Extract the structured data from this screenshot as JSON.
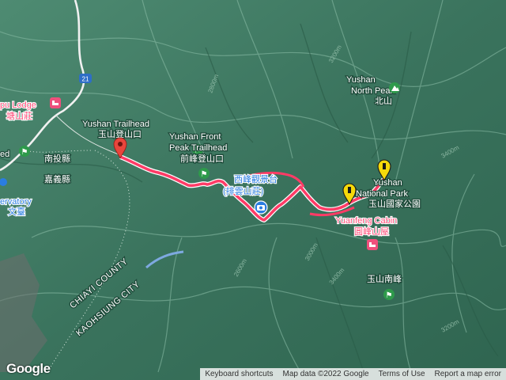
{
  "map": {
    "colors": {
      "terrain": "#3e7a63",
      "ridge": "#7fb39d",
      "route": "#ff3b66",
      "pin_red": "#e8453c",
      "pin_yellow": "#f5d90a",
      "hiker": "#2e9a4b",
      "lodging": "#ef4f7c",
      "river": "#7ea9e0",
      "road": "#f1f1f1"
    },
    "labels": {
      "lodge": "pu Lodge",
      "lodge_zh": "塘山莊",
      "trailhead_en": "Yushan Trailhead",
      "trailhead_zh": "玉山登山口",
      "front_peak_1": "Yushan Front",
      "front_peak_2": "Peak Trailhead",
      "front_peak_zh": "前峰登山口",
      "nantou": "南投縣",
      "chiayi": "嘉義縣",
      "observatory": "ervatory",
      "observatory_zh": "文臺",
      "west_peak_zh": "西峰觀景台",
      "west_peak_zh2": "(排雲山莊)",
      "yushan_np_1": "Yushan",
      "yushan_np_2": "National Park",
      "yushan_np_zh": "玉山國家公園",
      "north_peak_1": "Yushan",
      "north_peak_2": "North Peak",
      "north_peak_zh": "北山",
      "cabin_en": "Yuanfeng Cabin",
      "cabin_zh": "圓峰山屋",
      "south_peak_zh": "玉山南峰",
      "chiayi_county": "CHIAYI COUNTY",
      "kaohsiung_city": "KAOHSIUNG CITY",
      "road_number": "21",
      "hd_left": "ed"
    },
    "contours": [
      "2800m",
      "3200m",
      "3400m",
      "3000m",
      "2600m",
      "3200m",
      "3400m"
    ],
    "icons": [
      "red-pin-icon",
      "yellow-pin-icon",
      "hiker-icon",
      "lodging-icon",
      "camera-icon",
      "road-shield-icon"
    ]
  },
  "footer": {
    "keyboard": "Keyboard shortcuts",
    "mapdata": "Map data ©2022 Google",
    "terms": "Terms of Use",
    "report": "Report a map error"
  },
  "logo": "Google"
}
